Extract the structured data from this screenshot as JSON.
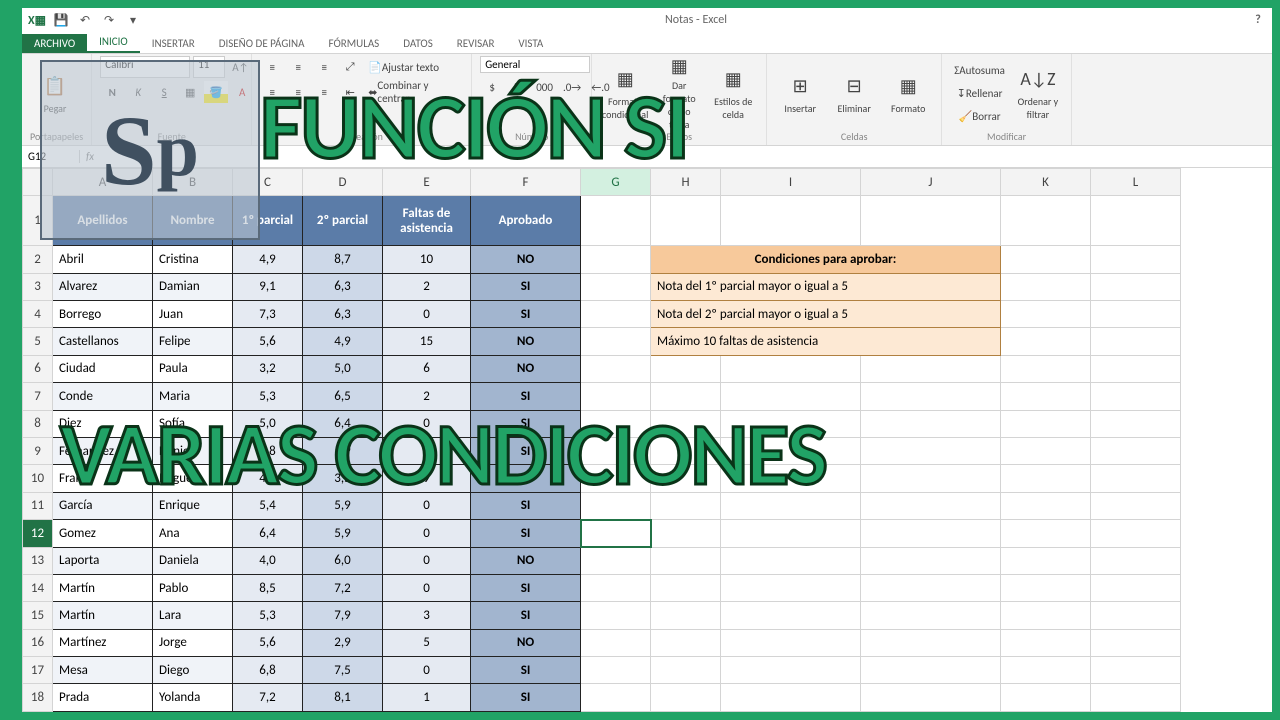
{
  "title": "Notas - Excel",
  "tabs": [
    "ARCHIVO",
    "INICIO",
    "INSERTAR",
    "DISEÑO DE PÁGINA",
    "FÓRMULAS",
    "DATOS",
    "REVISAR",
    "VISTA"
  ],
  "ribbon": {
    "clipboard": {
      "paste": "Pegar",
      "label": "Portapapeles"
    },
    "font": {
      "name": "Calibri",
      "size": "11",
      "label": "Fuente"
    },
    "align": {
      "wrap": "Ajustar texto",
      "merge": "Combinar y centrar",
      "label": "Alineación"
    },
    "number": {
      "format": "General",
      "label": "Número"
    },
    "styles": {
      "cond": "Formato condicional",
      "table": "Dar formato como tabla",
      "cell": "Estilos de celda",
      "label": "Estilos"
    },
    "cells": {
      "insert": "Insertar",
      "delete": "Eliminar",
      "format": "Formato",
      "label": "Celdas"
    },
    "editing": {
      "auto": "Autosuma",
      "fill": "Rellenar",
      "clear": "Borrar",
      "sort": "Ordenar y filtrar",
      "label": "Modificar"
    }
  },
  "namebox": "G12",
  "columns": [
    "A",
    "B",
    "C",
    "D",
    "E",
    "F",
    "G",
    "H",
    "I",
    "J",
    "K",
    "L"
  ],
  "headers": {
    "A": "Apellidos",
    "B": "Nombre",
    "C": "1º parcial",
    "D": "2º parcial",
    "E": "Faltas de asistencia",
    "F": "Aprobado"
  },
  "rows": [
    {
      "r": 2,
      "A": "Abril",
      "B": "Cristina",
      "C": "4,9",
      "D": "8,7",
      "E": "10",
      "F": "NO"
    },
    {
      "r": 3,
      "A": "Alvarez",
      "B": "Damian",
      "C": "9,1",
      "D": "6,3",
      "E": "2",
      "F": "SI"
    },
    {
      "r": 4,
      "A": "Borrego",
      "B": "Juan",
      "C": "7,3",
      "D": "6,3",
      "E": "0",
      "F": "SI"
    },
    {
      "r": 5,
      "A": "Castellanos",
      "B": "Felipe",
      "C": "5,6",
      "D": "4,9",
      "E": "15",
      "F": "NO"
    },
    {
      "r": 6,
      "A": "Ciudad",
      "B": "Paula",
      "C": "3,2",
      "D": "5,0",
      "E": "6",
      "F": "NO"
    },
    {
      "r": 7,
      "A": "Conde",
      "B": "Maria",
      "C": "5,3",
      "D": "6,5",
      "E": "2",
      "F": "SI"
    },
    {
      "r": 8,
      "A": "Diez",
      "B": "Sofía",
      "C": "5,0",
      "D": "6,4",
      "E": "0",
      "F": "SI"
    },
    {
      "r": 9,
      "A": "Fernandez",
      "B": "Daniela",
      "C": "5,8",
      "D": "5,9",
      "E": "1",
      "F": "SI"
    },
    {
      "r": 10,
      "A": "Fraile",
      "B": "Miguel",
      "C": "4,1",
      "D": "3,5",
      "E": "9",
      "F": "NO"
    },
    {
      "r": 11,
      "A": "García",
      "B": "Enrique",
      "C": "5,4",
      "D": "5,9",
      "E": "0",
      "F": "SI"
    },
    {
      "r": 12,
      "A": "Gomez",
      "B": "Ana",
      "C": "6,4",
      "D": "5,9",
      "E": "0",
      "F": "SI"
    },
    {
      "r": 13,
      "A": "Laporta",
      "B": "Daniela",
      "C": "4,0",
      "D": "6,0",
      "E": "0",
      "F": "NO"
    },
    {
      "r": 14,
      "A": "Martín",
      "B": "Pablo",
      "C": "8,5",
      "D": "7,2",
      "E": "0",
      "F": "SI"
    },
    {
      "r": 15,
      "A": "Martín",
      "B": "Lara",
      "C": "5,3",
      "D": "7,9",
      "E": "3",
      "F": "SI"
    },
    {
      "r": 16,
      "A": "Martínez",
      "B": "Jorge",
      "C": "5,6",
      "D": "2,9",
      "E": "5",
      "F": "NO"
    },
    {
      "r": 17,
      "A": "Mesa",
      "B": "Diego",
      "C": "6,8",
      "D": "7,5",
      "E": "0",
      "F": "SI"
    },
    {
      "r": 18,
      "A": "Prada",
      "B": "Yolanda",
      "C": "7,2",
      "D": "8,1",
      "E": "1",
      "F": "SI"
    }
  ],
  "infobox": {
    "title": "Condiciones para aprobar:",
    "lines": [
      "Nota del 1º parcial mayor o igual a 5",
      "Nota del 2º parcial mayor o igual a 5",
      "Máximo 10 faltas de asistencia"
    ]
  },
  "overlay": {
    "line1": "FUNCIÓN SI",
    "line2": "VARIAS CONDICIONES",
    "logo1": "S",
    "logo2": "p"
  },
  "selected": {
    "row": 12,
    "col": "G"
  },
  "col_widths": {
    "A": 100,
    "B": 80,
    "C": 70,
    "D": 80,
    "E": 88,
    "F": 110,
    "G": 70,
    "H": 70,
    "I": 140,
    "J": 140,
    "K": 90,
    "L": 90
  }
}
